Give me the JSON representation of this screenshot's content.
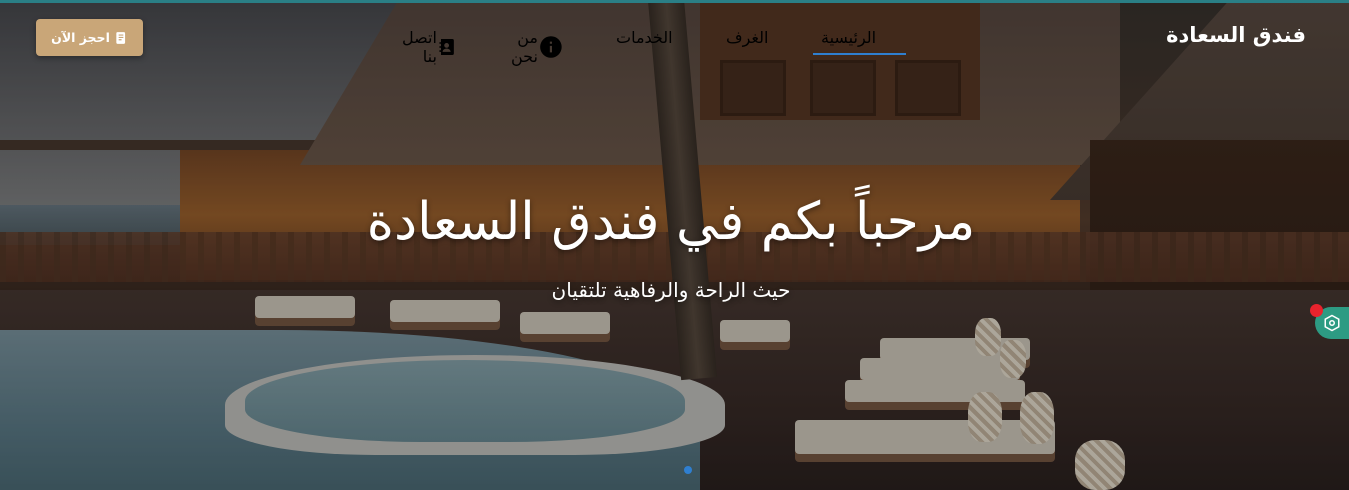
{
  "brand": {
    "name": "فندق السعادة"
  },
  "nav": {
    "items": [
      {
        "label": "الرئيسية",
        "icon": "home-icon",
        "active": true
      },
      {
        "label": "الغرف",
        "icon": "bed-icon",
        "active": false
      },
      {
        "label": "الخدمات",
        "icon": "utensils-icon",
        "active": false
      },
      {
        "label": "من نحن",
        "icon": "info-icon",
        "active": false
      },
      {
        "label": "اتصل بنا",
        "icon": "contact-book-icon",
        "active": false
      }
    ]
  },
  "cta": {
    "label": "احجز الآن",
    "icon": "book-icon"
  },
  "hero": {
    "title": "مرحباً بكم في فندق السعادة",
    "subtitle": "حيث الراحة والرفاهية تلتقيان"
  },
  "colors": {
    "accent": "#2f7fd0",
    "button": "#c9a678",
    "widget": "#2d9b83",
    "notification": "#e8232d",
    "topline": "#2a7f86"
  }
}
